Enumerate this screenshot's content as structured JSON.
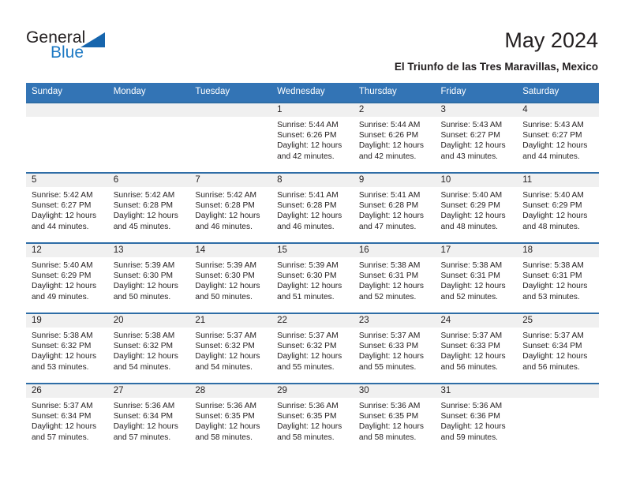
{
  "brand": {
    "name_top": "General",
    "name_bottom": "Blue",
    "triangle_icon": "triangle-icon",
    "accent_color": "#1e7ac4"
  },
  "header": {
    "title": "May 2024",
    "subtitle": "El Triunfo de las Tres Maravillas, Mexico"
  },
  "calendar": {
    "header_bg": "#3374b5",
    "row_border_color": "#2e6da6",
    "daynum_bg": "#f0f0f0",
    "weekdays": [
      "Sunday",
      "Monday",
      "Tuesday",
      "Wednesday",
      "Thursday",
      "Friday",
      "Saturday"
    ],
    "weeks": [
      [
        {
          "day": "",
          "empty": true
        },
        {
          "day": "",
          "empty": true
        },
        {
          "day": "",
          "empty": true
        },
        {
          "day": "1",
          "sunrise": "Sunrise: 5:44 AM",
          "sunset": "Sunset: 6:26 PM",
          "daylight_1": "Daylight: 12 hours",
          "daylight_2": "and 42 minutes."
        },
        {
          "day": "2",
          "sunrise": "Sunrise: 5:44 AM",
          "sunset": "Sunset: 6:26 PM",
          "daylight_1": "Daylight: 12 hours",
          "daylight_2": "and 42 minutes."
        },
        {
          "day": "3",
          "sunrise": "Sunrise: 5:43 AM",
          "sunset": "Sunset: 6:27 PM",
          "daylight_1": "Daylight: 12 hours",
          "daylight_2": "and 43 minutes."
        },
        {
          "day": "4",
          "sunrise": "Sunrise: 5:43 AM",
          "sunset": "Sunset: 6:27 PM",
          "daylight_1": "Daylight: 12 hours",
          "daylight_2": "and 44 minutes."
        }
      ],
      [
        {
          "day": "5",
          "sunrise": "Sunrise: 5:42 AM",
          "sunset": "Sunset: 6:27 PM",
          "daylight_1": "Daylight: 12 hours",
          "daylight_2": "and 44 minutes."
        },
        {
          "day": "6",
          "sunrise": "Sunrise: 5:42 AM",
          "sunset": "Sunset: 6:28 PM",
          "daylight_1": "Daylight: 12 hours",
          "daylight_2": "and 45 minutes."
        },
        {
          "day": "7",
          "sunrise": "Sunrise: 5:42 AM",
          "sunset": "Sunset: 6:28 PM",
          "daylight_1": "Daylight: 12 hours",
          "daylight_2": "and 46 minutes."
        },
        {
          "day": "8",
          "sunrise": "Sunrise: 5:41 AM",
          "sunset": "Sunset: 6:28 PM",
          "daylight_1": "Daylight: 12 hours",
          "daylight_2": "and 46 minutes."
        },
        {
          "day": "9",
          "sunrise": "Sunrise: 5:41 AM",
          "sunset": "Sunset: 6:28 PM",
          "daylight_1": "Daylight: 12 hours",
          "daylight_2": "and 47 minutes."
        },
        {
          "day": "10",
          "sunrise": "Sunrise: 5:40 AM",
          "sunset": "Sunset: 6:29 PM",
          "daylight_1": "Daylight: 12 hours",
          "daylight_2": "and 48 minutes."
        },
        {
          "day": "11",
          "sunrise": "Sunrise: 5:40 AM",
          "sunset": "Sunset: 6:29 PM",
          "daylight_1": "Daylight: 12 hours",
          "daylight_2": "and 48 minutes."
        }
      ],
      [
        {
          "day": "12",
          "sunrise": "Sunrise: 5:40 AM",
          "sunset": "Sunset: 6:29 PM",
          "daylight_1": "Daylight: 12 hours",
          "daylight_2": "and 49 minutes."
        },
        {
          "day": "13",
          "sunrise": "Sunrise: 5:39 AM",
          "sunset": "Sunset: 6:30 PM",
          "daylight_1": "Daylight: 12 hours",
          "daylight_2": "and 50 minutes."
        },
        {
          "day": "14",
          "sunrise": "Sunrise: 5:39 AM",
          "sunset": "Sunset: 6:30 PM",
          "daylight_1": "Daylight: 12 hours",
          "daylight_2": "and 50 minutes."
        },
        {
          "day": "15",
          "sunrise": "Sunrise: 5:39 AM",
          "sunset": "Sunset: 6:30 PM",
          "daylight_1": "Daylight: 12 hours",
          "daylight_2": "and 51 minutes."
        },
        {
          "day": "16",
          "sunrise": "Sunrise: 5:38 AM",
          "sunset": "Sunset: 6:31 PM",
          "daylight_1": "Daylight: 12 hours",
          "daylight_2": "and 52 minutes."
        },
        {
          "day": "17",
          "sunrise": "Sunrise: 5:38 AM",
          "sunset": "Sunset: 6:31 PM",
          "daylight_1": "Daylight: 12 hours",
          "daylight_2": "and 52 minutes."
        },
        {
          "day": "18",
          "sunrise": "Sunrise: 5:38 AM",
          "sunset": "Sunset: 6:31 PM",
          "daylight_1": "Daylight: 12 hours",
          "daylight_2": "and 53 minutes."
        }
      ],
      [
        {
          "day": "19",
          "sunrise": "Sunrise: 5:38 AM",
          "sunset": "Sunset: 6:32 PM",
          "daylight_1": "Daylight: 12 hours",
          "daylight_2": "and 53 minutes."
        },
        {
          "day": "20",
          "sunrise": "Sunrise: 5:38 AM",
          "sunset": "Sunset: 6:32 PM",
          "daylight_1": "Daylight: 12 hours",
          "daylight_2": "and 54 minutes."
        },
        {
          "day": "21",
          "sunrise": "Sunrise: 5:37 AM",
          "sunset": "Sunset: 6:32 PM",
          "daylight_1": "Daylight: 12 hours",
          "daylight_2": "and 54 minutes."
        },
        {
          "day": "22",
          "sunrise": "Sunrise: 5:37 AM",
          "sunset": "Sunset: 6:32 PM",
          "daylight_1": "Daylight: 12 hours",
          "daylight_2": "and 55 minutes."
        },
        {
          "day": "23",
          "sunrise": "Sunrise: 5:37 AM",
          "sunset": "Sunset: 6:33 PM",
          "daylight_1": "Daylight: 12 hours",
          "daylight_2": "and 55 minutes."
        },
        {
          "day": "24",
          "sunrise": "Sunrise: 5:37 AM",
          "sunset": "Sunset: 6:33 PM",
          "daylight_1": "Daylight: 12 hours",
          "daylight_2": "and 56 minutes."
        },
        {
          "day": "25",
          "sunrise": "Sunrise: 5:37 AM",
          "sunset": "Sunset: 6:34 PM",
          "daylight_1": "Daylight: 12 hours",
          "daylight_2": "and 56 minutes."
        }
      ],
      [
        {
          "day": "26",
          "sunrise": "Sunrise: 5:37 AM",
          "sunset": "Sunset: 6:34 PM",
          "daylight_1": "Daylight: 12 hours",
          "daylight_2": "and 57 minutes."
        },
        {
          "day": "27",
          "sunrise": "Sunrise: 5:36 AM",
          "sunset": "Sunset: 6:34 PM",
          "daylight_1": "Daylight: 12 hours",
          "daylight_2": "and 57 minutes."
        },
        {
          "day": "28",
          "sunrise": "Sunrise: 5:36 AM",
          "sunset": "Sunset: 6:35 PM",
          "daylight_1": "Daylight: 12 hours",
          "daylight_2": "and 58 minutes."
        },
        {
          "day": "29",
          "sunrise": "Sunrise: 5:36 AM",
          "sunset": "Sunset: 6:35 PM",
          "daylight_1": "Daylight: 12 hours",
          "daylight_2": "and 58 minutes."
        },
        {
          "day": "30",
          "sunrise": "Sunrise: 5:36 AM",
          "sunset": "Sunset: 6:35 PM",
          "daylight_1": "Daylight: 12 hours",
          "daylight_2": "and 58 minutes."
        },
        {
          "day": "31",
          "sunrise": "Sunrise: 5:36 AM",
          "sunset": "Sunset: 6:36 PM",
          "daylight_1": "Daylight: 12 hours",
          "daylight_2": "and 59 minutes."
        },
        {
          "day": "",
          "empty": true
        }
      ]
    ]
  }
}
